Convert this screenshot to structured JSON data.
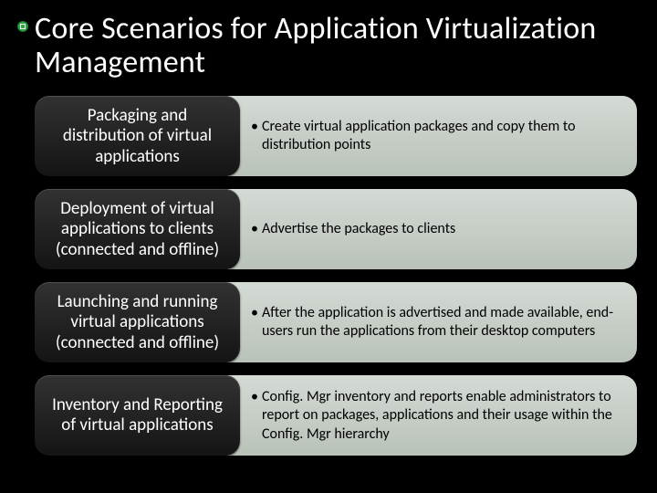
{
  "title": "Core Scenarios for Application Virtualization Management",
  "rows": [
    {
      "label": "Packaging and distribution of virtual applications",
      "bullet": "Create virtual application packages and copy them to distribution points"
    },
    {
      "label": "Deployment of virtual applications to clients (connected and offline)",
      "bullet": "Advertise the packages to clients"
    },
    {
      "label": "Launching and running virtual applications (connected and offline)",
      "bullet": "After the application is advertised and made available, end-users run the applications from their desktop computers"
    },
    {
      "label": "Inventory and Reporting of virtual applications",
      "bullet": "Config. Mgr inventory and reports enable administrators to report on packages, applications and their usage within the Config. Mgr hierarchy"
    }
  ]
}
